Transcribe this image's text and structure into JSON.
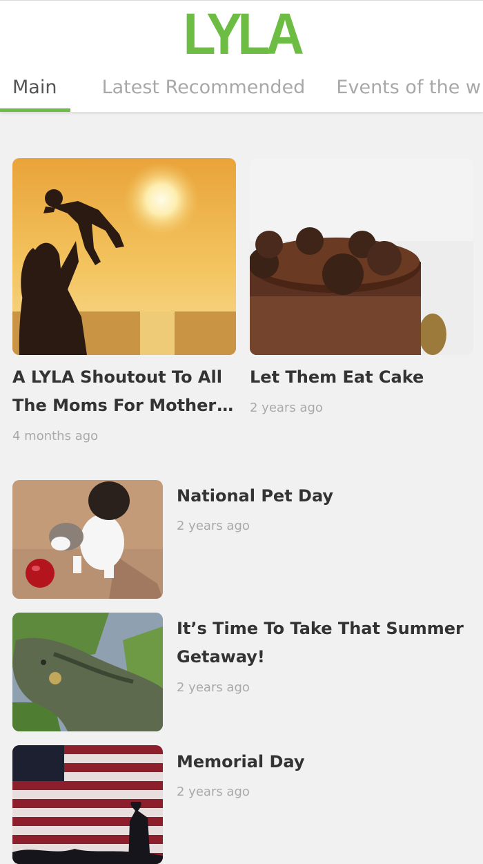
{
  "app": {
    "logo_text": "LYLA",
    "brand_color": "#6dbd45"
  },
  "tabs": [
    {
      "label": "Main",
      "active": true
    },
    {
      "label": "Latest Recommended",
      "active": false
    },
    {
      "label": "Events of the w",
      "active": false
    }
  ],
  "featured": [
    {
      "title": "A LYLA Shoutout To All The Moms For Mother’s Day",
      "time": "4 months ago",
      "image": "mother-lifting-baby-sunset-photo"
    },
    {
      "title": "Let Them Eat Cake",
      "time": "2 years ago",
      "image": "chocolate-cake-photo"
    }
  ],
  "list": [
    {
      "title": "National Pet Day",
      "time": "2 years ago",
      "image": "kitten-and-apple-photo"
    },
    {
      "title": "It’s Time To Take That Summer Getaway!",
      "time": "2 years ago",
      "image": "iguana-photo"
    },
    {
      "title": "Memorial Day",
      "time": "2 years ago",
      "image": "american-flag-salute-photo"
    }
  ]
}
